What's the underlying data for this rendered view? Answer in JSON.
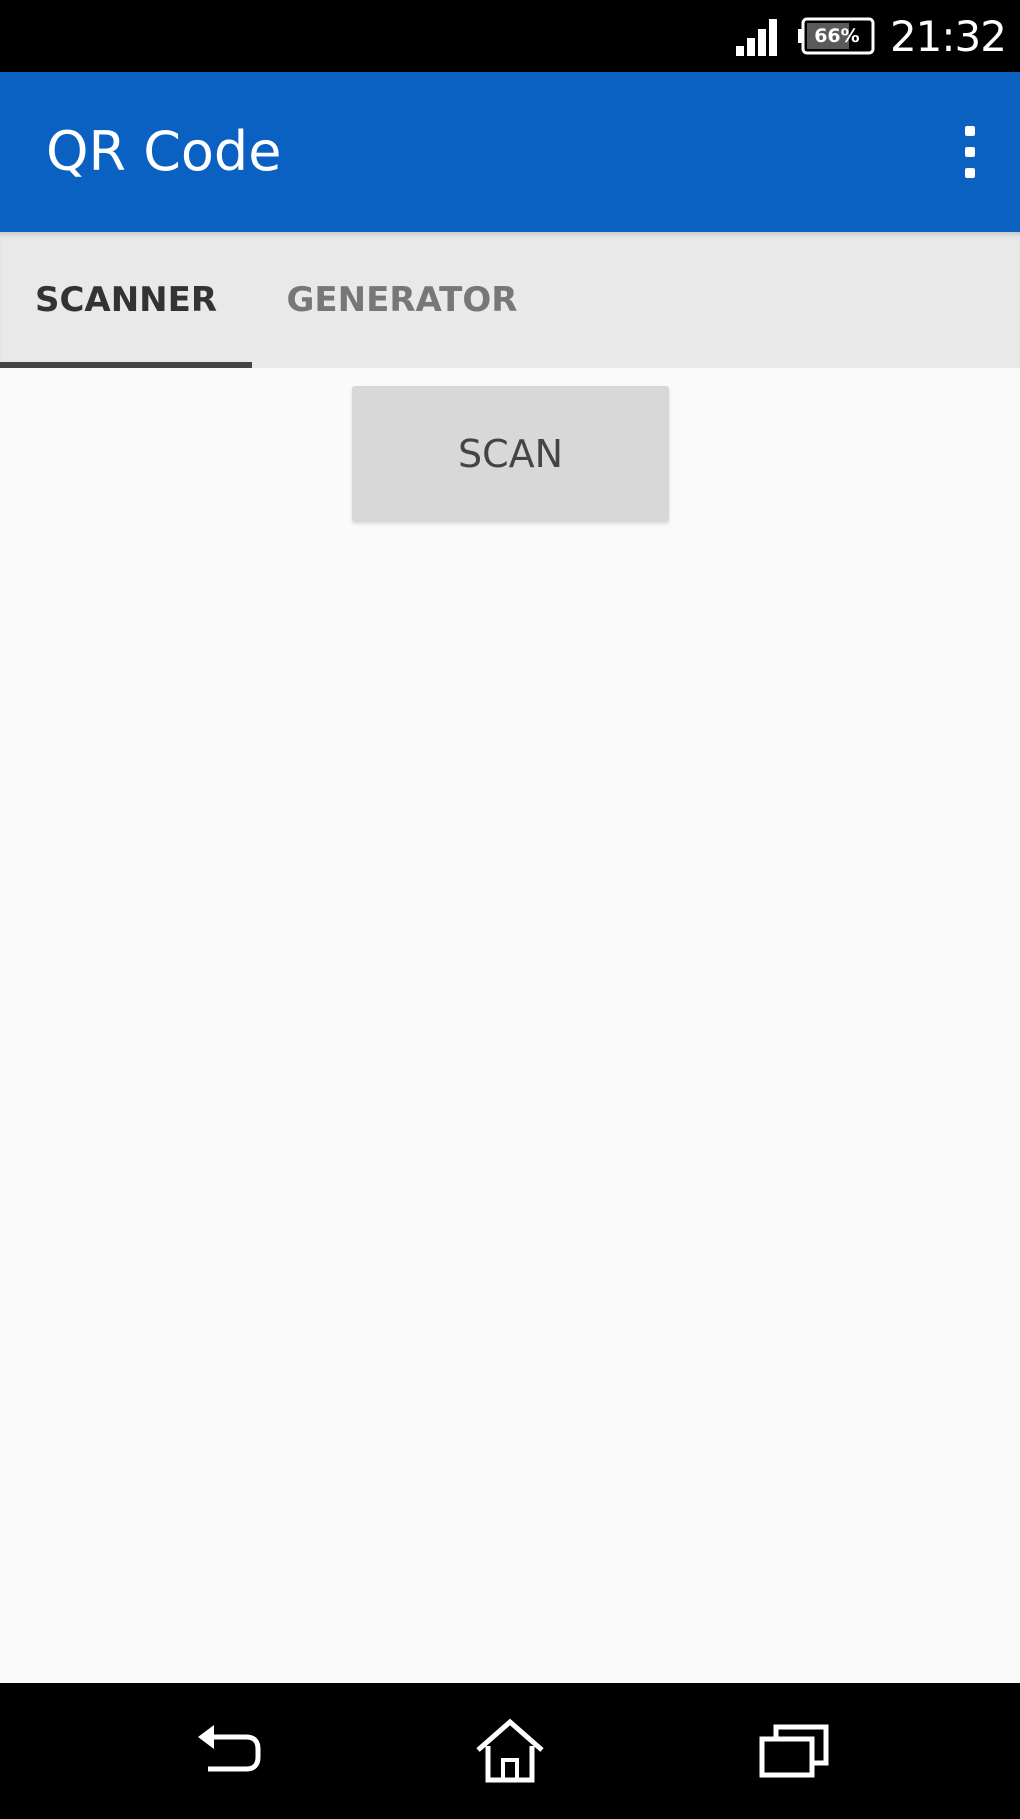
{
  "status_bar": {
    "battery_text": "66%",
    "time": "21:32",
    "icons": [
      "signal-icon",
      "battery-icon"
    ]
  },
  "app_bar": {
    "title": "QR Code",
    "menu_icon": "more-vert-icon"
  },
  "tabs": [
    {
      "label": "SCANNER",
      "selected": true
    },
    {
      "label": "GENERATOR",
      "selected": false
    }
  ],
  "main": {
    "scan_label": "SCAN"
  },
  "nav_bar": {
    "icons": [
      "back-icon",
      "home-icon",
      "recent-apps-icon"
    ]
  },
  "colors": {
    "app_bar": "#0a61c2",
    "tab_bar": "#e9e9e9",
    "background": "#fafafa",
    "button": "#d8d8d8"
  }
}
